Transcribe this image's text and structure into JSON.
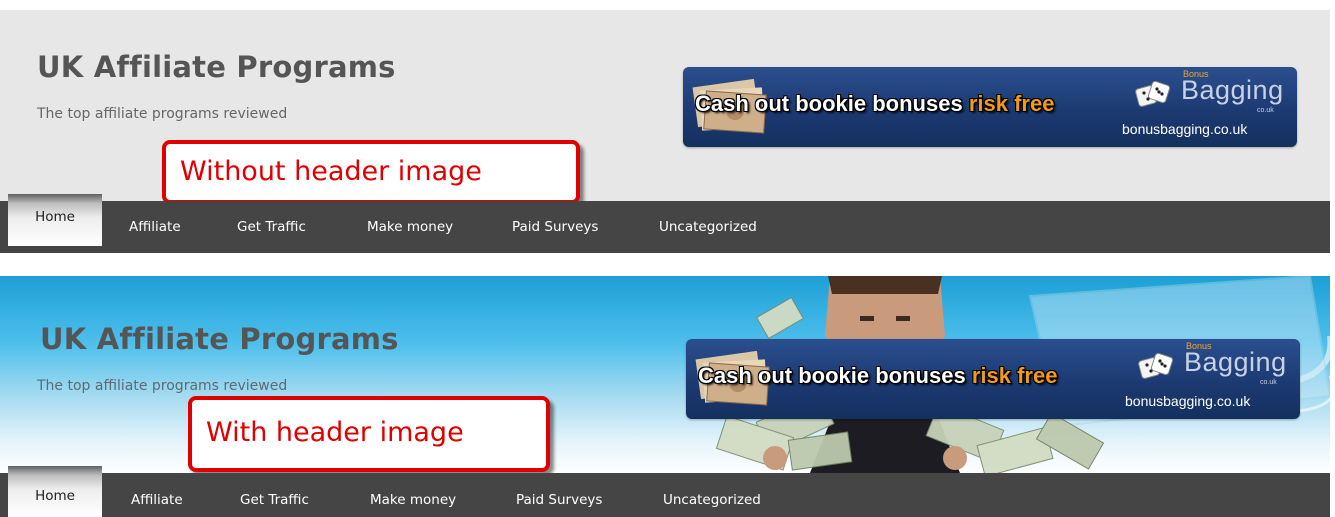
{
  "top": {
    "site_title": "UK Affiliate Programs",
    "tagline": "The top affiliate programs reviewed",
    "callout": "Without header image"
  },
  "bottom": {
    "site_title": "UK Affiliate Programs",
    "tagline": "The top affiliate programs reviewed",
    "callout": "With header image"
  },
  "ad": {
    "text_main": "Cash out bookie bonuses ",
    "text_accent": "risk free",
    "brand_small": "Bonus",
    "brand": "Bagging",
    "brand_suffix": "co.uk",
    "domain": "bonusbagging.co.uk"
  },
  "nav": {
    "items": [
      "Home",
      "Affiliate",
      "Get Traffic",
      "Make money",
      "Paid Surveys",
      "Uncategorized"
    ],
    "active": "Home"
  },
  "colors": {
    "nav_bg": "#454545",
    "header_plain_bg": "#e7e7e7",
    "header_image_sky": "#1d9fd6",
    "callout_red": "#e00000",
    "ad_blue": "#1c3a72",
    "ad_accent": "#f29a1a"
  },
  "icons": [
    "banknote-icon",
    "dice-icon"
  ]
}
